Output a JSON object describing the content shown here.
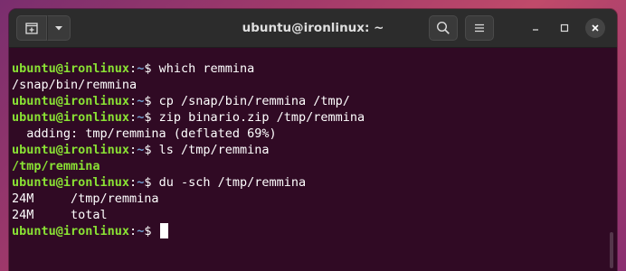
{
  "window": {
    "title": "ubuntu@ironlinux: ~"
  },
  "icons": {
    "new_tab": "new-tab-icon",
    "tab_menu": "chevron-down-icon",
    "search": "search-icon",
    "menu": "hamburger-menu-icon",
    "minimize": "minimize-icon",
    "maximize": "maximize-icon",
    "close": "close-icon"
  },
  "colors": {
    "terminal_bg": "#300a24",
    "prompt_user": "#8ae234",
    "prompt_path": "#729fcf",
    "titlebar": "#2c2c2c",
    "desktop": "#a33a6a"
  },
  "terminal": {
    "lines": [
      {
        "type": "prompt",
        "user": "ubuntu@ironlinux",
        "sep": ":",
        "path": "~",
        "symbol": "$ ",
        "command": "which remmina"
      },
      {
        "type": "output",
        "text": "/snap/bin/remmina"
      },
      {
        "type": "prompt",
        "user": "ubuntu@ironlinux",
        "sep": ":",
        "path": "~",
        "symbol": "$ ",
        "command": "cp /snap/bin/remmina /tmp/"
      },
      {
        "type": "prompt",
        "user": "ubuntu@ironlinux",
        "sep": ":",
        "path": "~",
        "symbol": "$ ",
        "command": "zip binario.zip /tmp/remmina"
      },
      {
        "type": "output",
        "text": "  adding: tmp/remmina (deflated 69%)"
      },
      {
        "type": "prompt",
        "user": "ubuntu@ironlinux",
        "sep": ":",
        "path": "~",
        "symbol": "$ ",
        "command": "ls /tmp/remmina"
      },
      {
        "type": "output_green",
        "text": "/tmp/remmina"
      },
      {
        "type": "prompt",
        "user": "ubuntu@ironlinux",
        "sep": ":",
        "path": "~",
        "symbol": "$ ",
        "command": "du -sch /tmp/remmina"
      },
      {
        "type": "output",
        "text": "24M\t/tmp/remmina"
      },
      {
        "type": "output",
        "text": "24M\ttotal"
      },
      {
        "type": "prompt_cursor",
        "user": "ubuntu@ironlinux",
        "sep": ":",
        "path": "~",
        "symbol": "$ ",
        "command": ""
      }
    ]
  }
}
